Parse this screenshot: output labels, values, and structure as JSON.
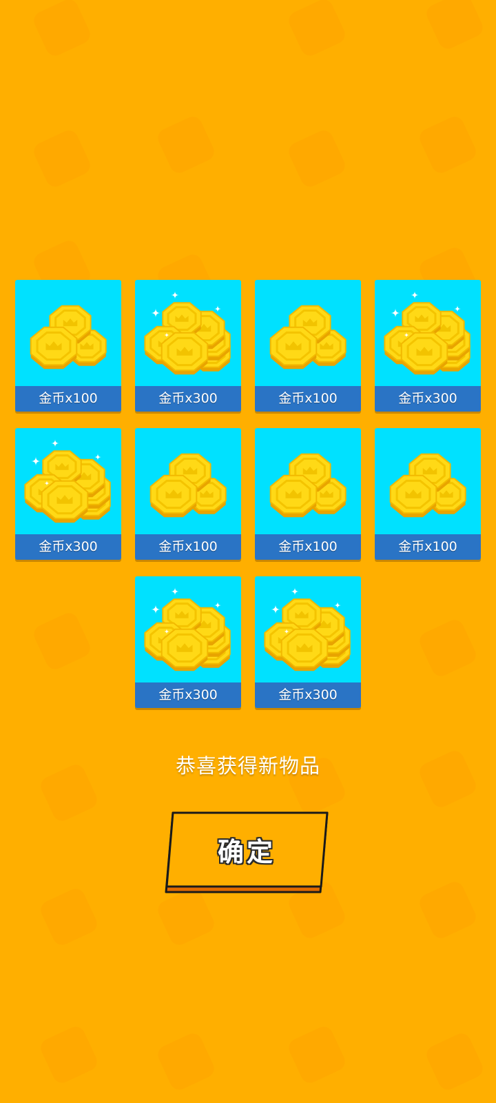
{
  "theme": {
    "background": "#FFAF00",
    "card_background": "#00E1FF",
    "card_label_background": "#2A74C5",
    "button_fill": "#FFAF00",
    "button_border": "#1A1A1A"
  },
  "rewards": [
    {
      "label": "金币x100",
      "icon": "coin-pile-small-icon"
    },
    {
      "label": "金币x300",
      "icon": "coin-pile-large-icon"
    },
    {
      "label": "金币x100",
      "icon": "coin-pile-small-icon"
    },
    {
      "label": "金币x300",
      "icon": "coin-pile-large-icon"
    },
    {
      "label": "金币x300",
      "icon": "coin-pile-large-icon"
    },
    {
      "label": "金币x100",
      "icon": "coin-pile-small-icon"
    },
    {
      "label": "金币x100",
      "icon": "coin-pile-small-icon"
    },
    {
      "label": "金币x100",
      "icon": "coin-pile-small-icon"
    },
    {
      "label": "金币x300",
      "icon": "coin-pile-large-icon"
    },
    {
      "label": "金币x300",
      "icon": "coin-pile-large-icon"
    }
  ],
  "message": "恭喜获得新物品",
  "confirm_button": {
    "label": "确定"
  }
}
